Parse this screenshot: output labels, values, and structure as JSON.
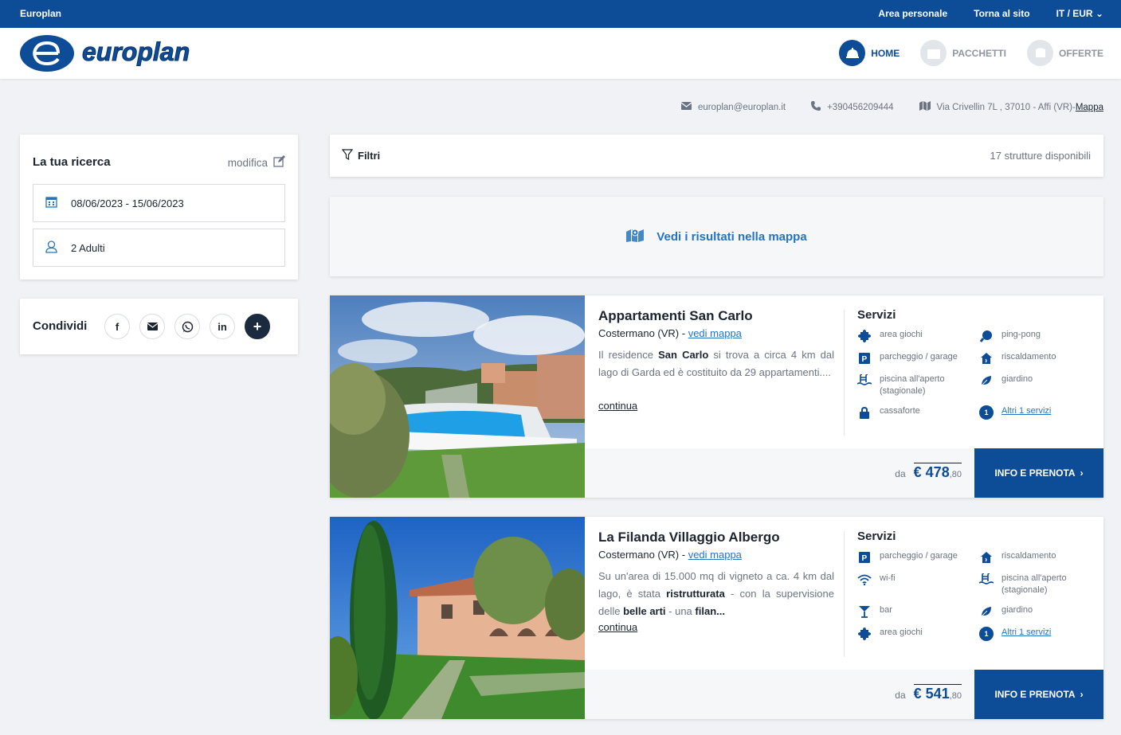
{
  "topbar": {
    "brand": "Europlan",
    "links": [
      "Area personale",
      "Torna al sito",
      "IT / EUR"
    ]
  },
  "header": {
    "logo_text": "europlan",
    "nav": [
      {
        "label": "HOME",
        "icon": "bell-icon",
        "active": true
      },
      {
        "label": "PACCHETTI",
        "icon": "gift-icon",
        "active": false
      },
      {
        "label": "OFFERTE",
        "icon": "coins-icon",
        "active": false
      }
    ]
  },
  "contacts": {
    "email": "europlan@europlan.it",
    "phone": "+390456209444",
    "address": "Via Crivellin 7L , 37010 - Affi (VR)-",
    "map_link": "Mappa"
  },
  "search": {
    "title": "La tua ricerca",
    "edit_label": "modifica",
    "dates": "08/06/2023 - 15/06/2023",
    "guests": "2 Adulti"
  },
  "share": {
    "title": "Condividi",
    "icons": [
      "facebook-icon",
      "email-icon",
      "whatsapp-icon",
      "linkedin-icon",
      "more-icon"
    ]
  },
  "filters": {
    "label": "Filtri",
    "count": "17 strutture disponibili"
  },
  "map_results": {
    "label": "Vedi i risultati nella mappa"
  },
  "hotels": [
    {
      "name": "Appartamenti San Carlo",
      "location": "Costermano (VR) -",
      "map_link": "vedi mappa",
      "desc_1": "Il residence ",
      "desc_b1": "San Carlo",
      "desc_2": " si trova a circa 4 km dal lago di Garda ed è costituito da 29 appartamenti....",
      "continue": "continua",
      "services_title": "Servizi",
      "services": [
        {
          "label": "area giochi",
          "icon": "puzzle-icon"
        },
        {
          "label": "ping-pong",
          "icon": "ping-pong-icon"
        },
        {
          "label": "parcheggio / garage",
          "icon": "parking-icon"
        },
        {
          "label": "riscaldamento",
          "icon": "heating-icon"
        },
        {
          "label": "piscina all'aperto (stagionale)",
          "icon": "pool-icon"
        },
        {
          "label": "giardino",
          "icon": "leaf-icon"
        },
        {
          "label": "cassaforte",
          "icon": "lock-icon"
        }
      ],
      "more_count": "1",
      "more_label": "Altri 1 servizi",
      "price_from": "da",
      "price_int": "€ 478",
      "price_dec": ",80",
      "cta": "INFO E PRENOTA"
    },
    {
      "name": "La Filanda Villaggio Albergo",
      "location": "Costermano (VR) -",
      "map_link": "vedi mappa",
      "desc_1": "Su un'area di 15.000 mq di vigneto a ca. 4 km dal lago, è stata ",
      "desc_b1": "ristrutturata",
      "desc_2": " - con la supervisione delle ",
      "desc_b2": "belle arti",
      "desc_3": " - una ",
      "desc_b3": "filan...",
      "continue": "continua",
      "services_title": "Servizi",
      "services": [
        {
          "label": "parcheggio / garage",
          "icon": "parking-icon"
        },
        {
          "label": "riscaldamento",
          "icon": "heating-icon"
        },
        {
          "label": "wi-fi",
          "icon": "wifi-icon"
        },
        {
          "label": "piscina all'aperto (stagionale)",
          "icon": "pool-icon"
        },
        {
          "label": "bar",
          "icon": "cocktail-icon"
        },
        {
          "label": "giardino",
          "icon": "leaf-icon"
        },
        {
          "label": "area giochi",
          "icon": "puzzle-icon"
        }
      ],
      "more_count": "1",
      "more_label": "Altri 1 servizi",
      "price_from": "da",
      "price_int": "€ 541",
      "price_dec": ",80",
      "cta": "INFO E PRENOTA"
    }
  ],
  "colors": {
    "brand": "#0d4c97",
    "link": "#2474c0",
    "background": "#f1f2f5"
  }
}
